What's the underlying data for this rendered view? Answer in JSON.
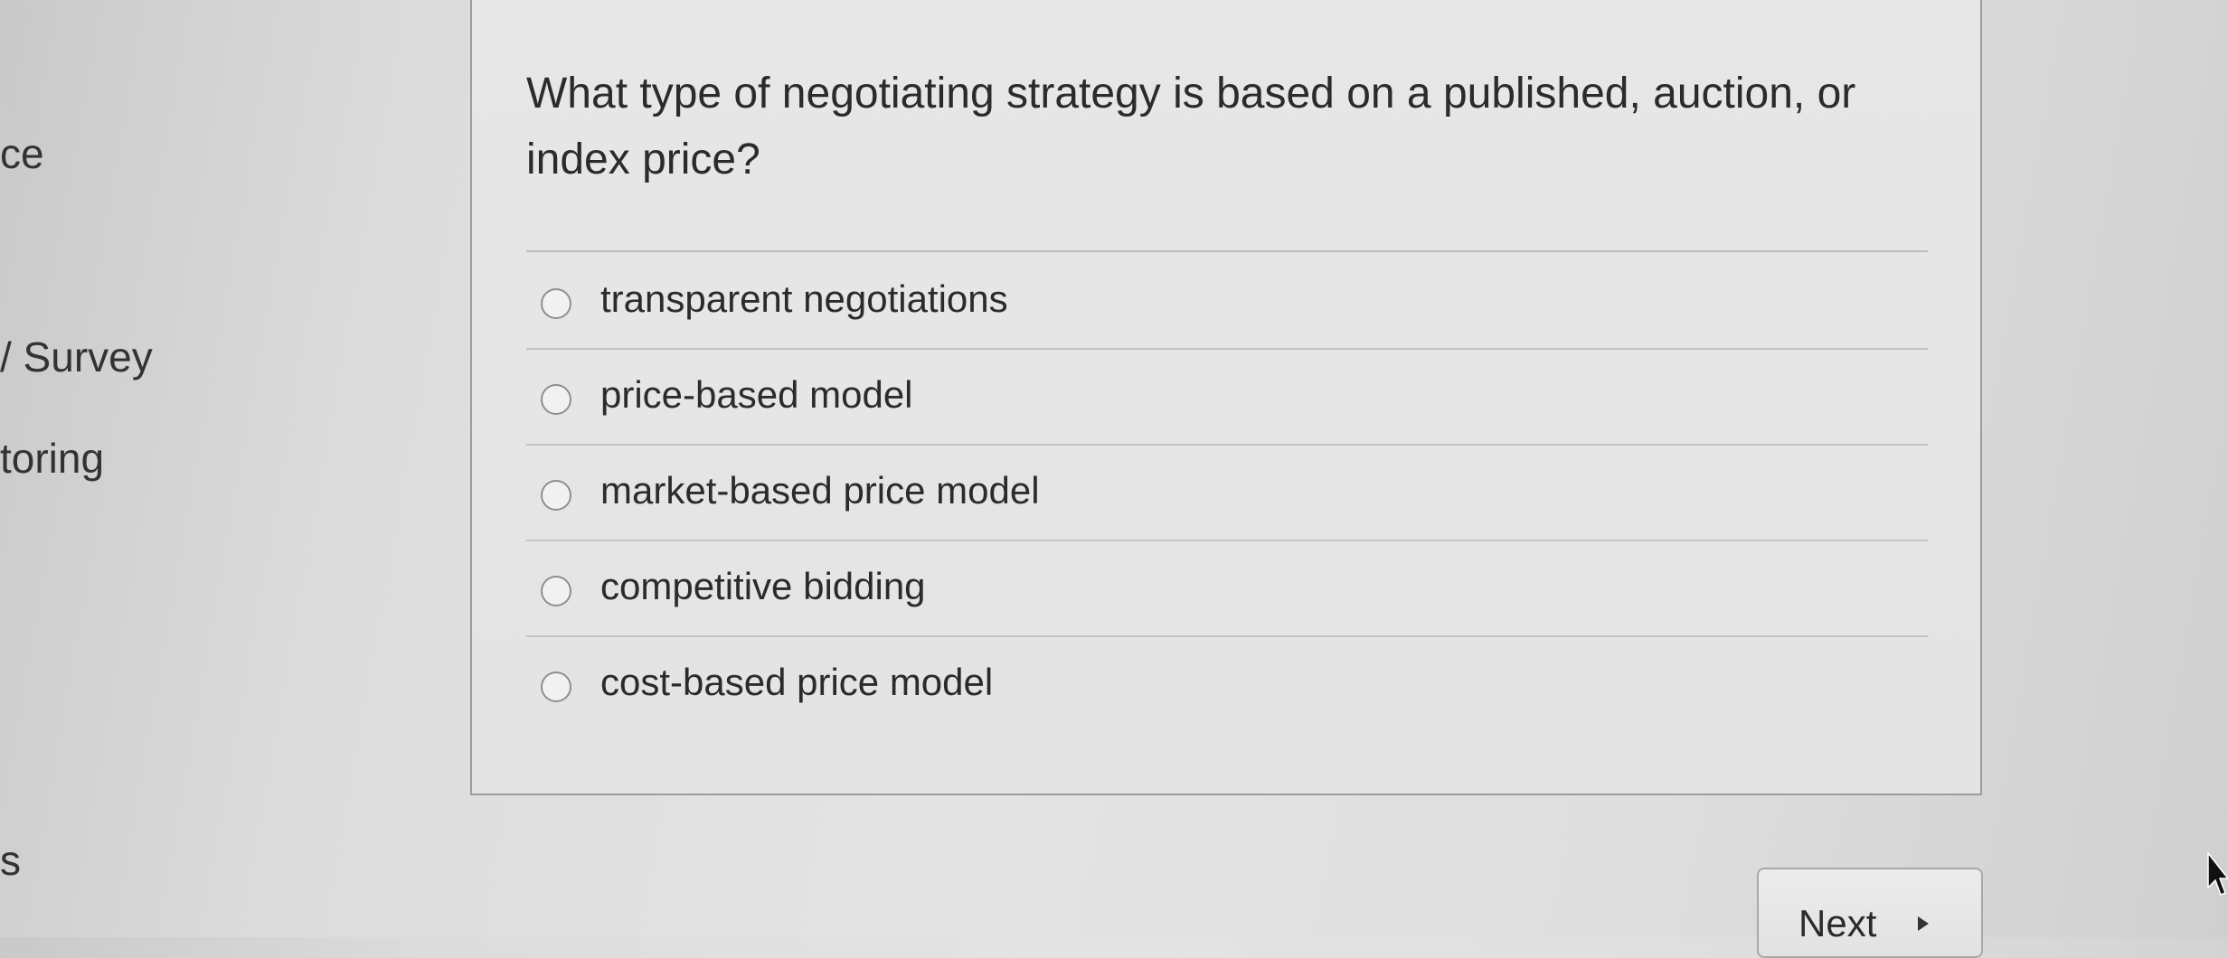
{
  "sidebar": {
    "items": [
      {
        "label": "ce"
      },
      {
        "label": "/ Survey"
      },
      {
        "label": "toring"
      },
      {
        "label": "s"
      }
    ]
  },
  "question": {
    "text": "What type of negotiating strategy is based on a published, auction, or index price?",
    "options": [
      {
        "label": "transparent negotiations",
        "selected": false
      },
      {
        "label": "price-based model",
        "selected": false
      },
      {
        "label": "market-based price model",
        "selected": false
      },
      {
        "label": "competitive bidding",
        "selected": false
      },
      {
        "label": "cost-based price model",
        "selected": false
      }
    ]
  },
  "navigation": {
    "next_label": "Next"
  },
  "icons": {
    "radio": "radio-unchecked-icon",
    "next_arrow": "play-triangle-icon",
    "cursor": "mouse-pointer-icon"
  },
  "colors": {
    "background": "#e4e4e4",
    "card_border": "#9c9c9c",
    "text": "#2b2b2b"
  }
}
